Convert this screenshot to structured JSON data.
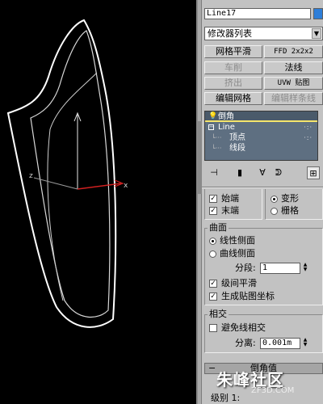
{
  "viewport": {
    "background": "#000000",
    "axis_labels": {
      "x": "x",
      "z": "z"
    }
  },
  "panel": {
    "object_name": "Line17",
    "object_color": "#2e7ed8",
    "modifier_list": "修改器列表",
    "buttons": [
      {
        "label": "网格平滑",
        "enabled": true
      },
      {
        "label": "FFD 2x2x2",
        "enabled": true
      },
      {
        "label": "车削",
        "enabled": false
      },
      {
        "label": "法线",
        "enabled": true
      },
      {
        "label": "挤出",
        "enabled": false
      },
      {
        "label": "UVW 贴图",
        "enabled": true
      },
      {
        "label": "编辑网格",
        "enabled": true
      },
      {
        "label": "编辑样条线",
        "enabled": false
      }
    ],
    "stack": {
      "items": [
        {
          "label": "倒角",
          "icon": "bulb-icon",
          "selected": true
        },
        {
          "label": "Line",
          "icon": "collapse-box-icon",
          "selected": false
        },
        {
          "label": "顶点",
          "icon": "tree-branch-icon",
          "selected": false
        },
        {
          "label": "线段",
          "icon": "tree-branch-icon",
          "selected": false
        }
      ]
    },
    "toolbar_icons": [
      "pin-stack-icon",
      "show-end-result-icon",
      "make-unique-icon",
      "remove-modifier-icon",
      "configure-sets-icon"
    ],
    "caps": {
      "start_cap": {
        "label": "始端",
        "checked": true
      },
      "end_cap": {
        "label": "末端",
        "checked": true
      },
      "morph": {
        "label": "变形",
        "selected": true
      },
      "grid": {
        "label": "栅格",
        "selected": false
      }
    },
    "surface": {
      "title": "曲面",
      "linear_sides": {
        "label": "线性侧面",
        "selected": true
      },
      "curved_sides": {
        "label": "曲线侧面",
        "selected": false
      },
      "segments_label": "分段:",
      "segments_value": "1",
      "smooth_across_levels": {
        "label": "级间平滑",
        "checked": true
      },
      "generate_mapping": {
        "label": "生成贴图坐标",
        "checked": true
      }
    },
    "intersections": {
      "title": "相交",
      "keep_lines_from_crossing": {
        "label": "避免线相交",
        "checked": false
      },
      "separation_label": "分离:",
      "separation_value": "0.001m"
    },
    "rollout_bevel_values": "倒角值",
    "footer_partial": "级别 1:"
  },
  "watermark": {
    "text": "朱峰社区",
    "sub": "ZF3D.COM"
  }
}
